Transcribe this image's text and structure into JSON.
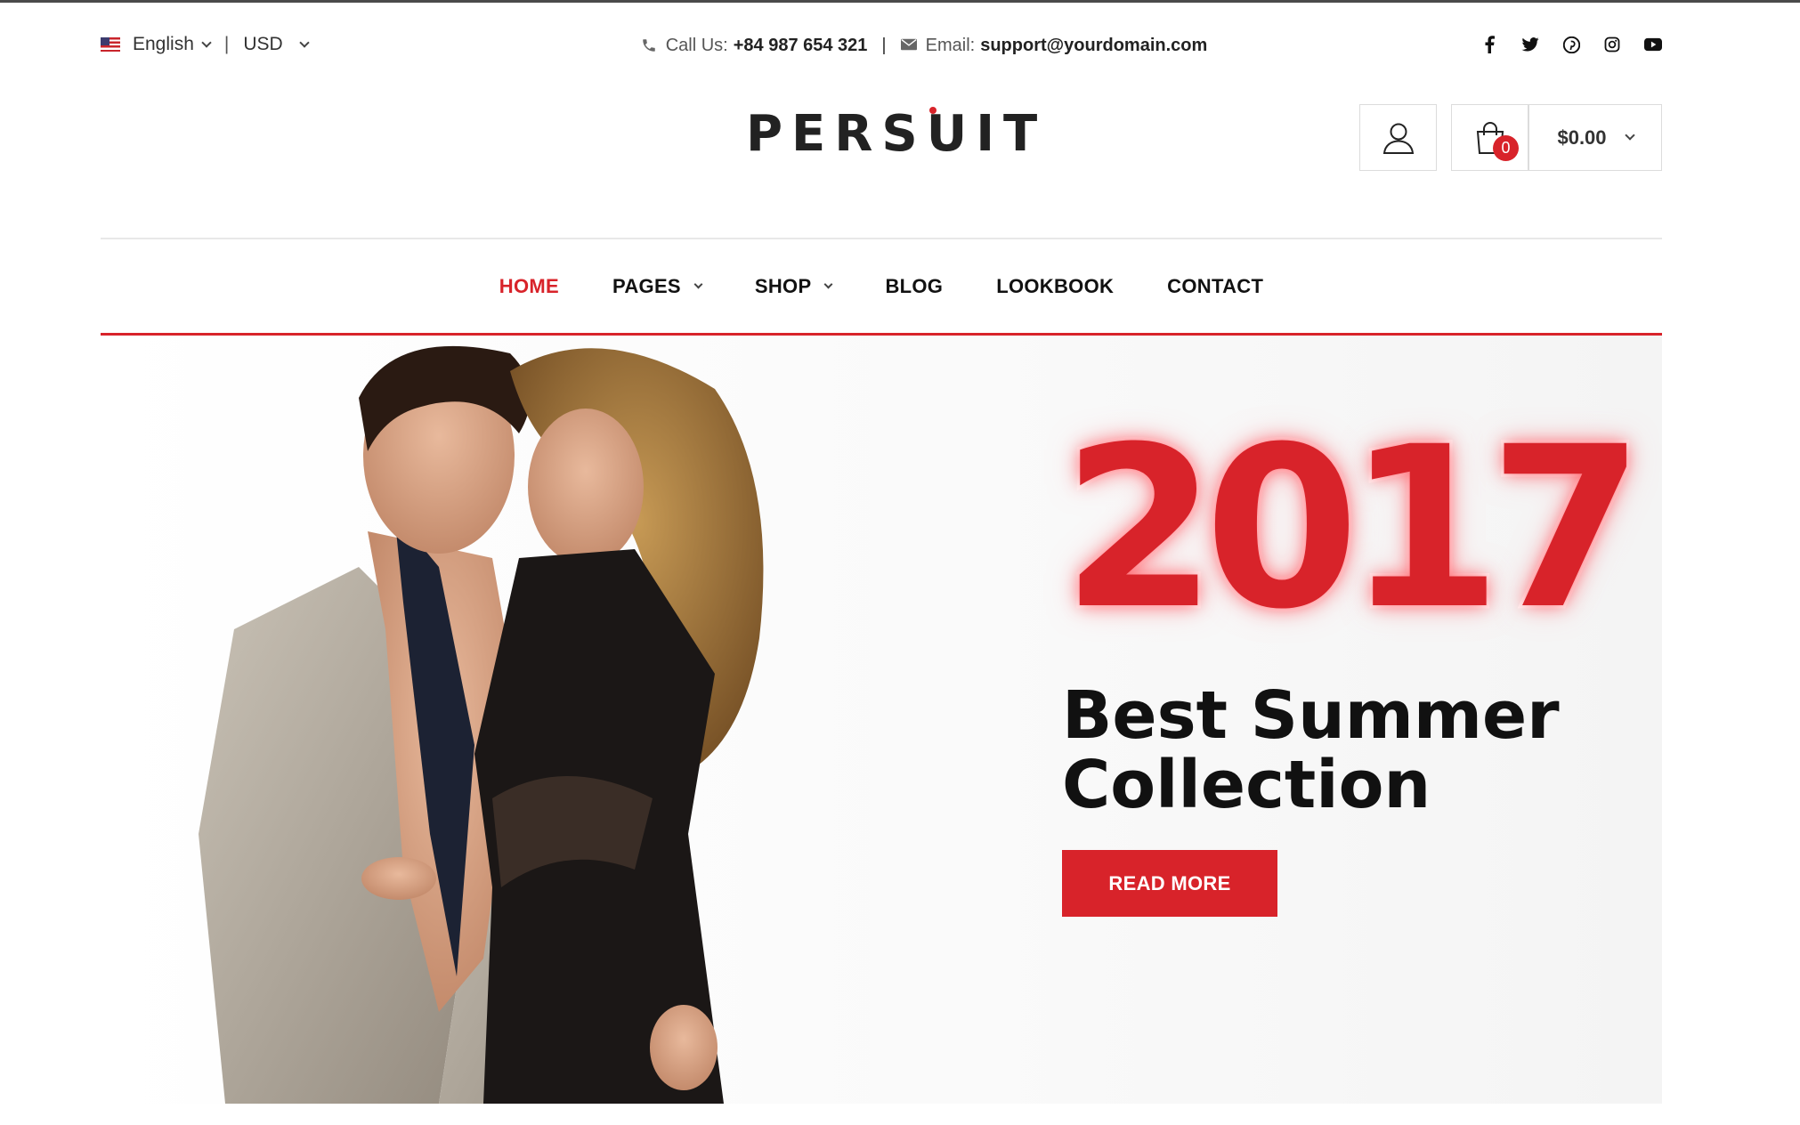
{
  "topbar": {
    "language": "English",
    "currency": "USD",
    "call_label": "Call Us:",
    "phone": "+84 987 654 321",
    "email_label": "Email:",
    "email": "support@yourdomain.com",
    "social_icons": [
      "facebook-icon",
      "twitter-icon",
      "pinterest-icon",
      "instagram-icon",
      "youtube-icon"
    ]
  },
  "header": {
    "logo": "PERSUIT",
    "cart_count": "0",
    "cart_total": "$0.00"
  },
  "nav": {
    "items": [
      {
        "label": "HOME",
        "active": true
      },
      {
        "label": "PAGES",
        "dropdown": true
      },
      {
        "label": "SHOP",
        "dropdown": true
      },
      {
        "label": "BLOG"
      },
      {
        "label": "LOOKBOOK"
      },
      {
        "label": "CONTACT"
      }
    ]
  },
  "hero": {
    "year": "2017",
    "headline_line1": "Best Summer",
    "headline_line2": "Collection",
    "button_label": "READ MORE"
  },
  "colors": {
    "accent": "#d8232a",
    "text": "#111111",
    "border": "#dcdcdc"
  }
}
